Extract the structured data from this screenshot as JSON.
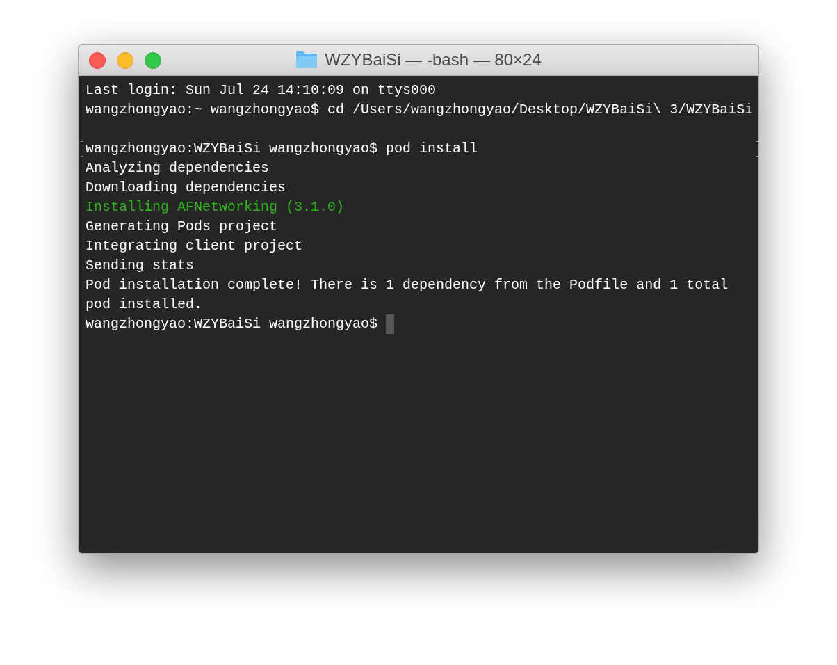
{
  "window": {
    "title": "WZYBaiSi — -bash — 80×24"
  },
  "lines": [
    {
      "kind": "text",
      "text": "Last login: Sun Jul 24 14:10:09 on ttys000",
      "color": "#ffffff"
    },
    {
      "kind": "text",
      "text": "wangzhongyao:~ wangzhongyao$ cd /Users/wangzhongyao/Desktop/WZYBaiSi\\ 3/WZYBaiSi",
      "color": "#ffffff"
    },
    {
      "kind": "blank"
    },
    {
      "kind": "text",
      "text": "wangzhongyao:WZYBaiSi wangzhongyao$ pod install",
      "color": "#ffffff",
      "marked": true
    },
    {
      "kind": "text",
      "text": "Analyzing dependencies",
      "color": "#ffffff"
    },
    {
      "kind": "text",
      "text": "Downloading dependencies",
      "color": "#ffffff"
    },
    {
      "kind": "text",
      "text": "Installing AFNetworking (3.1.0)",
      "color": "#2fb41b"
    },
    {
      "kind": "text",
      "text": "Generating Pods project",
      "color": "#ffffff"
    },
    {
      "kind": "text",
      "text": "Integrating client project",
      "color": "#ffffff"
    },
    {
      "kind": "text",
      "text": "Sending stats",
      "color": "#ffffff"
    },
    {
      "kind": "text",
      "text": "Pod installation complete! There is 1 dependency from the Podfile and 1 total",
      "color": "#ffffff"
    },
    {
      "kind": "text",
      "text": "pod installed.",
      "color": "#ffffff"
    },
    {
      "kind": "text",
      "text": "wangzhongyao:WZYBaiSi wangzhongyao$",
      "color": "#ffffff",
      "cursor": true
    }
  ]
}
